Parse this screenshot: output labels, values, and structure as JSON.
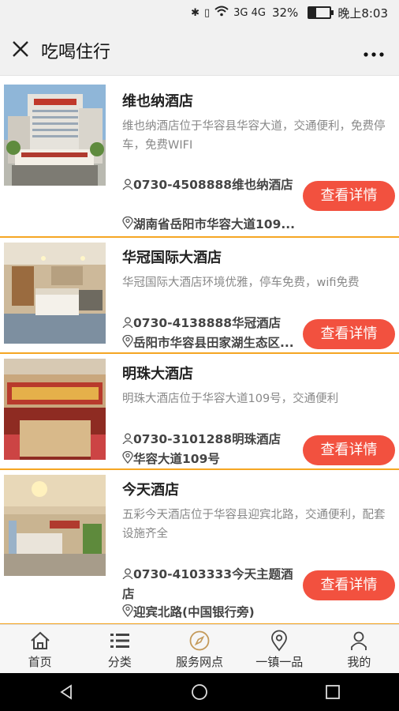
{
  "status_bar": {
    "signal_text": "3G 4G",
    "battery_percent": "32%",
    "battery_level": 0.32,
    "time": "晚上8:03"
  },
  "title_bar": {
    "close_icon": "close-icon",
    "title": "吃喝住行",
    "more_icon": "more-icon"
  },
  "hotels": [
    {
      "name": "维也纳酒店",
      "desc": "维也纳酒店位于华容县华容大道，交通便利，免费停车，免费WIFI",
      "phone": "0730-4508888维也纳酒店",
      "address": "湖南省岳阳市华容大道109...",
      "button": "查看详情"
    },
    {
      "name": "华冠国际大酒店",
      "desc": "华冠国际大酒店环境优雅，停车免费，wifi免费",
      "phone": "0730-4138888华冠酒店",
      "address": "岳阳市华容县田家湖生态区...",
      "button": "查看详情"
    },
    {
      "name": "明珠大酒店",
      "desc": "明珠大酒店位于华容大道109号，交通便利",
      "phone": "0730-3101288明珠酒店",
      "address": "华容大道109号",
      "button": "查看详情"
    },
    {
      "name": "今天酒店",
      "desc": "五彩今天酒店位于华容县迎宾北路，交通便利，配套设施齐全",
      "phone": "0730-4103333今天主题酒店",
      "address": "迎宾北路(中国银行旁)",
      "button": "查看详情"
    }
  ],
  "tab_bar": {
    "items": [
      {
        "label": "首页",
        "icon": "home-icon"
      },
      {
        "label": "分类",
        "icon": "list-icon"
      },
      {
        "label": "服务网点",
        "icon": "compass-icon"
      },
      {
        "label": "一镇一品",
        "icon": "location-icon"
      },
      {
        "label": "我的",
        "icon": "user-icon"
      }
    ]
  },
  "nav_bar": {
    "icons": [
      "back-icon",
      "home-circle-icon",
      "recents-icon"
    ]
  },
  "colors": {
    "accent": "#f2513f",
    "divider": "#f5a623",
    "header_bg": "#f1f1f1"
  }
}
